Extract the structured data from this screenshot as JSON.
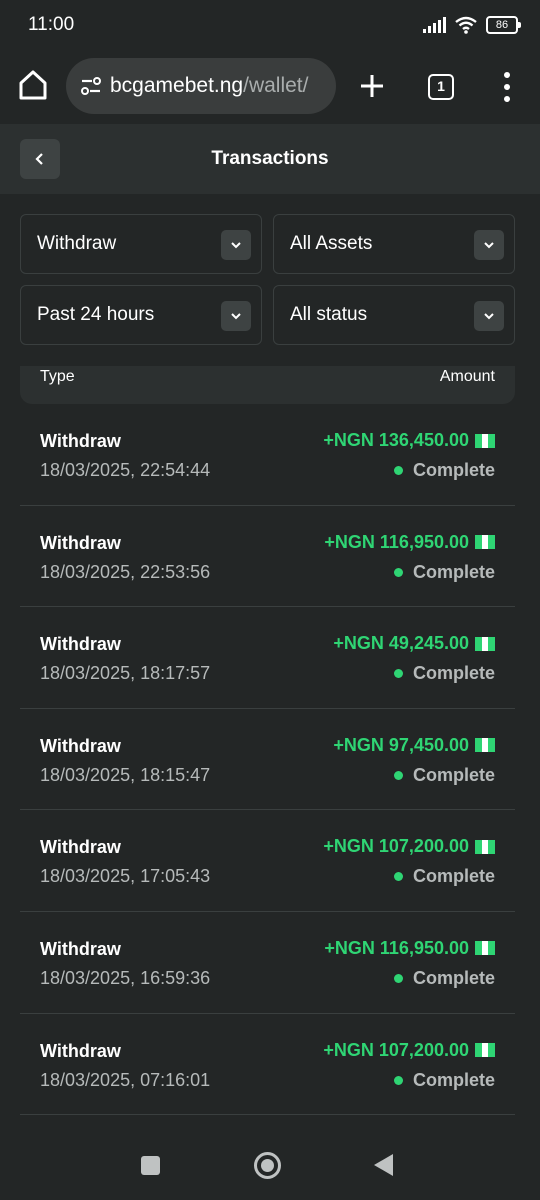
{
  "status_bar": {
    "time": "11:00",
    "battery": "86"
  },
  "browser": {
    "url_domain": "bcgamebet.ng",
    "url_path": "/wallet/",
    "tab_count": "1"
  },
  "header": {
    "title": "Transactions"
  },
  "filters": {
    "type": "Withdraw",
    "assets": "All Assets",
    "period": "Past 24 hours",
    "status": "All status"
  },
  "table": {
    "col_type": "Type",
    "col_amount": "Amount",
    "rows": [
      {
        "type": "Withdraw",
        "date": "18/03/2025, 22:54:44",
        "amount": "+NGN 136,450.00",
        "status": "Complete"
      },
      {
        "type": "Withdraw",
        "date": "18/03/2025, 22:53:56",
        "amount": "+NGN 116,950.00",
        "status": "Complete"
      },
      {
        "type": "Withdraw",
        "date": "18/03/2025, 18:17:57",
        "amount": "+NGN 49,245.00",
        "status": "Complete"
      },
      {
        "type": "Withdraw",
        "date": "18/03/2025, 18:15:47",
        "amount": "+NGN 97,450.00",
        "status": "Complete"
      },
      {
        "type": "Withdraw",
        "date": "18/03/2025, 17:05:43",
        "amount": "+NGN 107,200.00",
        "status": "Complete"
      },
      {
        "type": "Withdraw",
        "date": "18/03/2025, 16:59:36",
        "amount": "+NGN 116,950.00",
        "status": "Complete"
      },
      {
        "type": "Withdraw",
        "date": "18/03/2025, 07:16:01",
        "amount": "+NGN 107,200.00",
        "status": "Complete"
      }
    ]
  },
  "colors": {
    "background": "#232626",
    "panel": "#2c3030",
    "positive_amount": "#2fd574",
    "status_complete": "#2fd574",
    "muted_text": "#b6baba"
  },
  "icons": {
    "home": "home-icon",
    "site_settings": "tune-icon",
    "new_tab": "plus-icon",
    "tabs": "tab-count-icon",
    "more": "more-vertical-icon",
    "back": "chevron-left-icon",
    "dropdown": "chevron-down-icon",
    "currency_flag": "nigeria-flag-icon"
  }
}
